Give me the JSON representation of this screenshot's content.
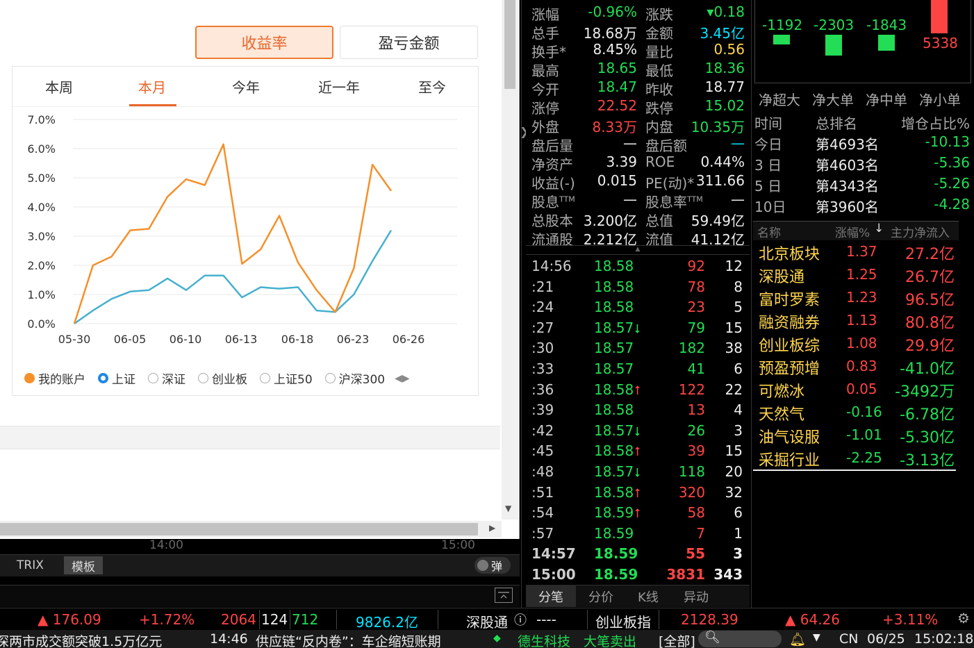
{
  "popup": {
    "btn_rate": "收益率",
    "btn_pl": "盈亏金额",
    "period_tabs": [
      "本周",
      "本月",
      "今年",
      "近一年",
      "至今"
    ],
    "legend": [
      "我的账户",
      "上证",
      "深证",
      "创业板",
      "上证50",
      "沪深300"
    ]
  },
  "chart_data": {
    "type": "line",
    "x_ticks": [
      "05-30",
      "06-05",
      "06-10",
      "06-13",
      "06-18",
      "06-23",
      "06-26"
    ],
    "y_ticks": [
      "7.0%",
      "6.0%",
      "5.0%",
      "4.0%",
      "3.0%",
      "2.0%",
      "1.0%",
      "0.0%"
    ],
    "ylim": [
      0,
      7
    ],
    "series": [
      {
        "name": "我的账户",
        "color": "#f5902a",
        "values": [
          0.0,
          2.0,
          2.3,
          3.2,
          3.25,
          4.35,
          4.95,
          4.75,
          6.15,
          2.05,
          2.55,
          3.7,
          2.1,
          1.15,
          0.4,
          1.9,
          5.45,
          4.55
        ]
      },
      {
        "name": "上证",
        "color": "#46b0cf",
        "values": [
          0.0,
          0.45,
          0.85,
          1.1,
          1.15,
          1.55,
          1.15,
          1.65,
          1.65,
          0.9,
          1.25,
          1.2,
          1.25,
          0.45,
          0.4,
          1.0,
          2.15,
          3.2
        ]
      }
    ]
  },
  "time_axis": [
    "14:00",
    "15:00"
  ],
  "indicator": {
    "trix": "TRIX",
    "template": "模板",
    "pop": "弹"
  },
  "quote": [
    {
      "l1": "涨幅",
      "v1": "-0.96%",
      "c1": "green",
      "l2": "涨跌",
      "v2": "▾0.18",
      "c2": "green"
    },
    {
      "l1": "总手",
      "v1": "18.68万",
      "c1": "white",
      "l2": "金额",
      "v2": "3.45亿",
      "c2": "cyan"
    },
    {
      "l1": "换手*",
      "v1": "8.45%",
      "c1": "white",
      "l2": "量比",
      "v2": "0.56",
      "c2": "yellow"
    },
    {
      "l1": "最高",
      "v1": "18.65",
      "c1": "green",
      "l2": "最低",
      "v2": "18.36",
      "c2": "green"
    },
    {
      "l1": "今开",
      "v1": "18.47",
      "c1": "green",
      "l2": "昨收",
      "v2": "18.77",
      "c2": "white"
    },
    {
      "l1": "涨停",
      "v1": "22.52",
      "c1": "red",
      "l2": "跌停",
      "v2": "15.02",
      "c2": "green"
    },
    {
      "l1": "外盘",
      "v1": "8.33万",
      "c1": "red",
      "l2": "内盘",
      "v2": "10.35万",
      "c2": "green"
    },
    {
      "l1": "盘后量",
      "v1": "—",
      "c1": "white",
      "l2": "盘后额",
      "v2": "—",
      "c2": "cyan"
    },
    {
      "l1": "净资产",
      "v1": "3.39",
      "c1": "white",
      "l2": "ROE",
      "v2": "0.44%",
      "c2": "white"
    },
    {
      "l1": "收益(-)",
      "v1": "0.015",
      "c1": "white",
      "l2": "PE(动)*",
      "v2": "311.66",
      "c2": "white"
    },
    {
      "l1": "股息",
      "l1s": "TTM",
      "v1": "—",
      "c1": "white",
      "l2": "股息率",
      "l2s": "TTM",
      "v2": "—",
      "c2": "white"
    },
    {
      "l1": "总股本",
      "v1": "3.200亿",
      "c1": "white",
      "l2": "总值",
      "v2": "59.49亿",
      "c2": "white"
    },
    {
      "l1": "流通股",
      "v1": "2.212亿",
      "c1": "white",
      "l2": "流值",
      "v2": "41.12亿",
      "c2": "white"
    }
  ],
  "ticks": [
    {
      "t": "14:56",
      "p": "18.58",
      "a": "",
      "v": "92",
      "vc": "red",
      "n": "12"
    },
    {
      "t": ":21",
      "p": "18.58",
      "a": "",
      "v": "78",
      "vc": "red",
      "n": "8"
    },
    {
      "t": ":24",
      "p": "18.58",
      "a": "",
      "v": "23",
      "vc": "red",
      "n": "5"
    },
    {
      "t": ":27",
      "p": "18.57",
      "a": "down",
      "v": "79",
      "vc": "green",
      "n": "15"
    },
    {
      "t": ":30",
      "p": "18.57",
      "a": "",
      "v": "182",
      "vc": "green",
      "n": "38"
    },
    {
      "t": ":33",
      "p": "18.57",
      "a": "",
      "v": "41",
      "vc": "green",
      "n": "6"
    },
    {
      "t": ":36",
      "p": "18.58",
      "a": "up",
      "v": "122",
      "vc": "red",
      "n": "22"
    },
    {
      "t": ":39",
      "p": "18.58",
      "a": "",
      "v": "13",
      "vc": "red",
      "n": "4"
    },
    {
      "t": ":42",
      "p": "18.57",
      "a": "down",
      "v": "26",
      "vc": "green",
      "n": "3"
    },
    {
      "t": ":45",
      "p": "18.58",
      "a": "up",
      "v": "39",
      "vc": "red",
      "n": "15"
    },
    {
      "t": ":48",
      "p": "18.57",
      "a": "down",
      "v": "118",
      "vc": "green",
      "n": "20"
    },
    {
      "t": ":51",
      "p": "18.58",
      "a": "up",
      "v": "320",
      "vc": "red",
      "n": "32"
    },
    {
      "t": ":54",
      "p": "18.59",
      "a": "up",
      "v": "58",
      "vc": "red",
      "n": "6"
    },
    {
      "t": ":57",
      "p": "18.59",
      "a": "",
      "v": "7",
      "vc": "red",
      "n": "1"
    },
    {
      "t": "14:57",
      "p": "18.59",
      "a": "",
      "v": "55",
      "vc": "red",
      "n": "3"
    },
    {
      "t": "15:00",
      "p": "18.59",
      "a": "",
      "v": "3831",
      "vc": "red",
      "n": "343"
    }
  ],
  "tick_tabs": [
    "分笔",
    "分价",
    "K线",
    "异动"
  ],
  "flow": {
    "values": [
      "-1192",
      "-2303",
      "-1843",
      "5338"
    ],
    "heads": [
      "净超大",
      "净大单",
      "净中单",
      "净小单"
    ]
  },
  "rank": {
    "heads": [
      "时间",
      "总排名",
      "增仓占比%"
    ],
    "rows": [
      {
        "l": "今日",
        "m": "第4693名",
        "r": "-10.13"
      },
      {
        "l": "3 日",
        "m": "第4603名",
        "r": "-5.36"
      },
      {
        "l": "5 日",
        "m": "第4343名",
        "r": "-5.26"
      },
      {
        "l": "10日",
        "m": "第3960名",
        "r": "-4.28"
      }
    ]
  },
  "sector": {
    "heads": [
      "名称",
      "涨幅%",
      "主力净流入"
    ],
    "sort_arrow": "↓",
    "rows": [
      {
        "n": "北京板块",
        "p": "1.37",
        "pc": "red",
        "f": "27.2亿",
        "fc": "red"
      },
      {
        "n": "深股通",
        "p": "1.25",
        "pc": "red",
        "f": "26.7亿",
        "fc": "red"
      },
      {
        "n": "富时罗素",
        "p": "1.23",
        "pc": "red",
        "f": "96.5亿",
        "fc": "red"
      },
      {
        "n": "融资融券",
        "p": "1.13",
        "pc": "red",
        "f": "80.8亿",
        "fc": "red"
      },
      {
        "n": "创业板综",
        "p": "1.08",
        "pc": "red",
        "f": "29.9亿",
        "fc": "red"
      },
      {
        "n": "预盈预增",
        "p": "0.83",
        "pc": "red",
        "f": "-41.0亿",
        "fc": "green"
      },
      {
        "n": "可燃冰",
        "p": "0.05",
        "pc": "red",
        "f": "-3492万",
        "fc": "green"
      },
      {
        "n": "天然气",
        "p": "-0.16",
        "pc": "green",
        "f": "-6.78亿",
        "fc": "green"
      },
      {
        "n": "油气设服",
        "p": "-1.01",
        "pc": "green",
        "f": "-5.30亿",
        "fc": "green"
      },
      {
        "n": "采掘行业",
        "p": "-2.25",
        "pc": "green",
        "f": "-3.13亿",
        "fc": "green"
      }
    ]
  },
  "status1": {
    "a1": "▲ 176.09",
    "a2": "+1.72%",
    "a3": "2064",
    "a4": "124",
    "a5": "712",
    "a6": "9826.2亿",
    "sgt": "深股通",
    "sgt_val": "----",
    "idx_name": "创业板指",
    "idx_val": "2128.39",
    "idx_chg": "▲ 64.26",
    "idx_pct": "+3.11%"
  },
  "status2": {
    "news1": "深两市成交额突破1.5万亿元",
    "news2_time": "14:46",
    "news2": "供应链“反内卷”：车企缩短账期 ",
    "alert_stock": "德生科技",
    "alert_type": "大笔卖出",
    "filter": "[全部]",
    "region": "CN",
    "date": "06/25",
    "time": "15:02:18"
  }
}
